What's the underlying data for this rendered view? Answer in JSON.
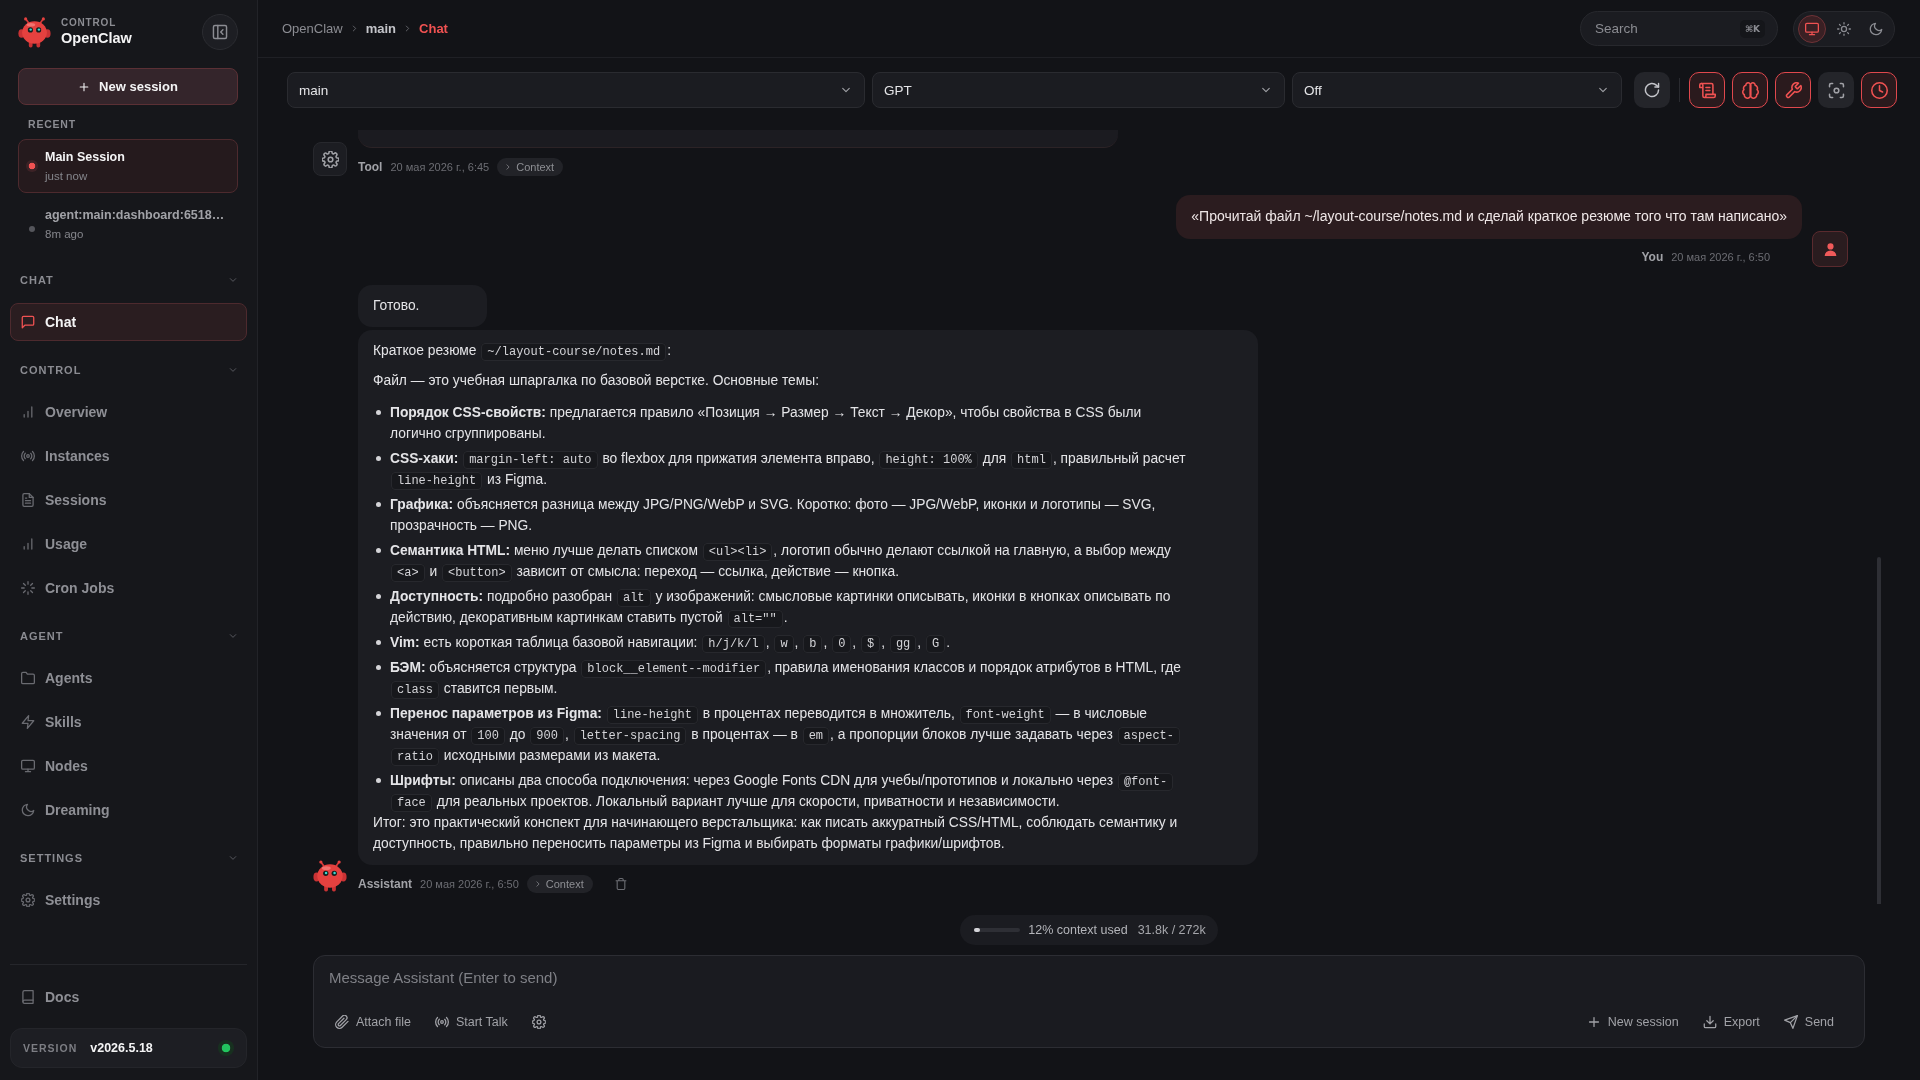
{
  "sidebar": {
    "brand": {
      "caption": "CONTROL",
      "name": "OpenClaw"
    },
    "new_session": "New session",
    "recent": {
      "title": "RECENT",
      "items": [
        {
          "title": "Main Session",
          "time": "just now",
          "selected": true
        },
        {
          "title": "agent:main:dashboard:6518…",
          "time": "8m ago",
          "selected": false
        }
      ]
    },
    "sections": [
      {
        "title": "CHAT",
        "expanded": true,
        "items": [
          {
            "label": "Chat",
            "selected": true
          }
        ]
      },
      {
        "title": "CONTROL",
        "expanded": true,
        "items": [
          {
            "label": "Overview",
            "selected": false
          },
          {
            "label": "Instances",
            "selected": false
          },
          {
            "label": "Sessions",
            "selected": false
          },
          {
            "label": "Usage",
            "selected": false
          },
          {
            "label": "Cron Jobs",
            "selected": false
          }
        ]
      },
      {
        "title": "AGENT",
        "expanded": true,
        "items": [
          {
            "label": "Agents",
            "selected": false
          },
          {
            "label": "Skills",
            "selected": false
          },
          {
            "label": "Nodes",
            "selected": false
          },
          {
            "label": "Dreaming",
            "selected": false
          }
        ]
      },
      {
        "title": "SETTINGS",
        "expanded": true,
        "items": [
          {
            "label": "Settings",
            "selected": false
          }
        ]
      }
    ],
    "docs": "Docs",
    "version": {
      "label": "VERSION",
      "value": "v2026.5.18",
      "online": true
    }
  },
  "topbar": {
    "breadcrumb": [
      {
        "label": "OpenClaw",
        "selected": false
      },
      {
        "label": "main",
        "selected": false
      },
      {
        "label": "Chat",
        "selected": true
      }
    ],
    "search": {
      "placeholder": "Search",
      "shortcut": "⌘K"
    },
    "theme_modes": [
      {
        "selected": true
      },
      {
        "selected": false
      },
      {
        "selected": false
      }
    ]
  },
  "toolbar": {
    "selects": [
      {
        "value": "main"
      },
      {
        "value": "GPT"
      },
      {
        "value": "Off"
      }
    ],
    "toggles": [
      {
        "on": true
      },
      {
        "on": true
      },
      {
        "on": true
      },
      {
        "on": false
      },
      {
        "on": true
      }
    ]
  },
  "messages": [
    {
      "kind": "tool",
      "author": "Tool",
      "time": "20 мая 2026 г., 6:45",
      "context": "Context"
    },
    {
      "kind": "user",
      "author": "You",
      "time": "20 мая 2026 г., 6:50",
      "text": "«Прочитай файл ~/layout-course/notes.md и сделай краткое резюме того что там написано»"
    },
    {
      "kind": "assistant",
      "author": "Assistant",
      "time": "20 мая 2026 г., 6:50",
      "context": "Context",
      "bubbles": [
        {
          "blocks": [
            {
              "kind": "paragraph",
              "parts": [
                {
                  "kind": "text",
                  "text": "Готово."
                }
              ]
            }
          ]
        },
        {
          "blocks": [
            {
              "kind": "paragraph",
              "parts": [
                {
                  "kind": "text",
                  "text": "Краткое резюме "
                },
                {
                  "kind": "code",
                  "text": "~/layout-course/notes.md"
                },
                {
                  "kind": "text",
                  "text": ":"
                }
              ]
            },
            {
              "kind": "paragraph",
              "parts": [
                {
                  "kind": "text",
                  "text": "Файл — это учебная шпаргалка по базовой верстке. Основные темы:"
                }
              ]
            },
            {
              "kind": "list",
              "items": [
                {
                  "parts": [
                    {
                      "kind": "text",
                      "text": "**Порядок CSS-свойств:** предлагается правило «Позиция → Размер → Текст → Декор», чтобы свойства в CSS были логично сгруппированы."
                    }
                  ]
                },
                {
                  "parts": [
                    {
                      "kind": "text",
                      "text": "**CSS-хаки:** "
                    },
                    {
                      "kind": "code",
                      "text": "margin-left: auto"
                    },
                    {
                      "kind": "text",
                      "text": " во flexbox для прижатия элемента вправо, "
                    },
                    {
                      "kind": "code",
                      "text": "height: 100%"
                    },
                    {
                      "kind": "text",
                      "text": " для "
                    },
                    {
                      "kind": "code",
                      "text": "html"
                    },
                    {
                      "kind": "text",
                      "text": ", правильный расчет "
                    },
                    {
                      "kind": "code",
                      "text": "line-height"
                    },
                    {
                      "kind": "text",
                      "text": " из Figma."
                    }
                  ]
                },
                {
                  "parts": [
                    {
                      "kind": "text",
                      "text": "**Графика:** объясняется разница между JPG/PNG/WebP и SVG. Коротко: фото — JPG/WebP, иконки и логотипы — SVG, прозрачность — PNG."
                    }
                  ]
                },
                {
                  "parts": [
                    {
                      "kind": "text",
                      "text": "**Семантика HTML:** меню лучше делать списком "
                    },
                    {
                      "kind": "code",
                      "text": "<ul><li>"
                    },
                    {
                      "kind": "text",
                      "text": ", логотип обычно делают ссылкой на главную, а выбор между "
                    },
                    {
                      "kind": "code",
                      "text": "<a>"
                    },
                    {
                      "kind": "text",
                      "text": " и "
                    },
                    {
                      "kind": "code",
                      "text": "<button>"
                    },
                    {
                      "kind": "text",
                      "text": " зависит от смысла: переход — ссылка, действие — кнопка."
                    }
                  ]
                },
                {
                  "parts": [
                    {
                      "kind": "text",
                      "text": "**Доступность:** подробно разобран "
                    },
                    {
                      "kind": "code",
                      "text": "alt"
                    },
                    {
                      "kind": "text",
                      "text": " у изображений: смысловые картинки описывать, иконки в кнопках описывать по действию, декоративным картинкам ставить пустой "
                    },
                    {
                      "kind": "code",
                      "text": "alt=\"\""
                    },
                    {
                      "kind": "text",
                      "text": "."
                    }
                  ]
                },
                {
                  "parts": [
                    {
                      "kind": "text",
                      "text": "**Vim:** есть короткая таблица базовой навигации: "
                    },
                    {
                      "kind": "code",
                      "text": "h/j/k/l"
                    },
                    {
                      "kind": "text",
                      "text": ", "
                    },
                    {
                      "kind": "code",
                      "text": "w"
                    },
                    {
                      "kind": "text",
                      "text": ", "
                    },
                    {
                      "kind": "code",
                      "text": "b"
                    },
                    {
                      "kind": "text",
                      "text": ", "
                    },
                    {
                      "kind": "code",
                      "text": "0"
                    },
                    {
                      "kind": "text",
                      "text": ", "
                    },
                    {
                      "kind": "code",
                      "text": "$"
                    },
                    {
                      "kind": "text",
                      "text": ", "
                    },
                    {
                      "kind": "code",
                      "text": "gg"
                    },
                    {
                      "kind": "text",
                      "text": ", "
                    },
                    {
                      "kind": "code",
                      "text": "G"
                    },
                    {
                      "kind": "text",
                      "text": "."
                    }
                  ]
                },
                {
                  "parts": [
                    {
                      "kind": "text",
                      "text": "**БЭМ:** объясняется структура "
                    },
                    {
                      "kind": "code",
                      "text": "block__element--modifier"
                    },
                    {
                      "kind": "text",
                      "text": ", правила именования классов и порядок атрибутов в HTML, где "
                    },
                    {
                      "kind": "code",
                      "text": "class"
                    },
                    {
                      "kind": "text",
                      "text": " ставится первым."
                    }
                  ]
                },
                {
                  "parts": [
                    {
                      "kind": "text",
                      "text": "**Перенос параметров из Figma:** "
                    },
                    {
                      "kind": "code",
                      "text": "line-height"
                    },
                    {
                      "kind": "text",
                      "text": " в процентах переводится в множитель, "
                    },
                    {
                      "kind": "code",
                      "text": "font-weight"
                    },
                    {
                      "kind": "text",
                      "text": " — в числовые значения от "
                    },
                    {
                      "kind": "code",
                      "text": "100"
                    },
                    {
                      "kind": "text",
                      "text": " до "
                    },
                    {
                      "kind": "code",
                      "text": "900"
                    },
                    {
                      "kind": "text",
                      "text": ", "
                    },
                    {
                      "kind": "code",
                      "text": "letter-spacing"
                    },
                    {
                      "kind": "text",
                      "text": " в процентах — в "
                    },
                    {
                      "kind": "code",
                      "text": "em"
                    },
                    {
                      "kind": "text",
                      "text": ", а пропорции блоков лучше задавать через "
                    },
                    {
                      "kind": "code",
                      "text": "aspect-ratio"
                    },
                    {
                      "kind": "text",
                      "text": " исходными размерами из макета."
                    }
                  ]
                },
                {
                  "parts": [
                    {
                      "kind": "text",
                      "text": "**Шрифты:** описаны два способа подключения: через Google Fonts CDN для учебы/прототипов и локально через "
                    },
                    {
                      "kind": "code",
                      "text": "@font-face"
                    },
                    {
                      "kind": "text",
                      "text": " для реальных проектов. Локальный вариант лучше для скорости, приватности и независимости."
                    }
                  ]
                }
              ]
            },
            {
              "kind": "paragraph",
              "parts": [
                {
                  "kind": "text",
                  "text": "Итог: это практический конспект для начинающего верстальщика: как писать аккуратный CSS/HTML, соблюдать семантику и доступность, правильно переносить параметры из Figma и выбирать форматы графики/шрифтов."
                }
              ]
            }
          ]
        }
      ]
    }
  ],
  "context_meter": {
    "label": "12% context used",
    "tokens": "31.8k / 272k",
    "level": 0.12
  },
  "composer": {
    "placeholder": "Message Assistant (Enter to send)",
    "left_actions": [
      "Attach file",
      "Start Talk"
    ],
    "right_actions": [
      "New session",
      "Export",
      "Send"
    ]
  }
}
